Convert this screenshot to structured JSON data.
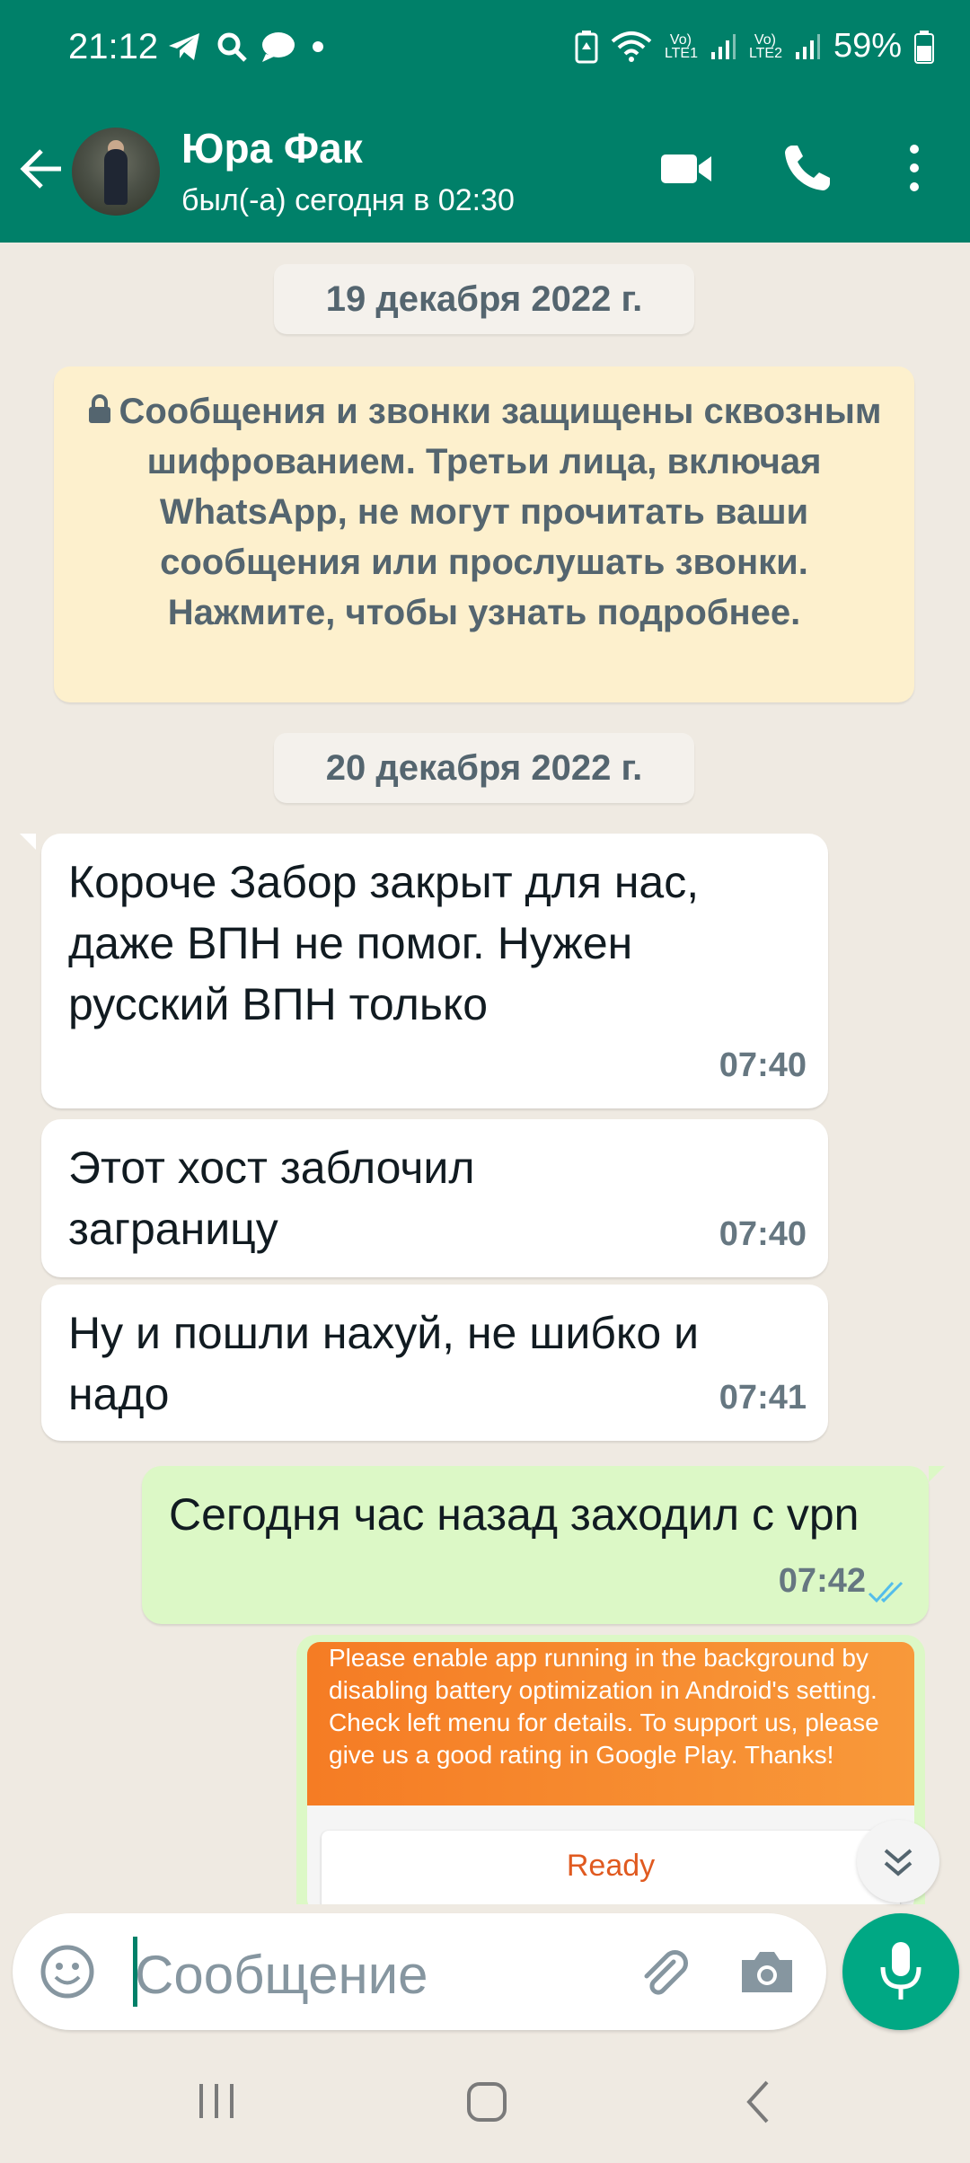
{
  "status_bar": {
    "time": "21:12",
    "sim1_label": "Vo) LTE1",
    "sim2_label": "Vo) LTE2",
    "battery": "59%"
  },
  "header": {
    "contact_name": "Юра Фак",
    "last_seen": "был(-а) сегодня в 02:30",
    "icons": [
      "back-arrow-icon",
      "video-call-icon",
      "voice-call-icon",
      "more-options-icon"
    ]
  },
  "chat": {
    "date1": "19 декабря 2022 г.",
    "encryption_notice": "Сообщения и звонки защищены сквозным шифрованием. Третьи лица, включая WhatsApp, не могут прочитать ваши сообщения или прослушать звонки. Нажмите, чтобы узнать подробнее.",
    "date2": "20 декабря 2022 г.",
    "messages": [
      {
        "direction": "in",
        "text": "Короче Забор закрыт для нас, даже ВПН не помог. Нужен русский ВПН только",
        "time": "07:40"
      },
      {
        "direction": "in",
        "text": "Этот хост заблочил заграницу",
        "time": "07:40"
      },
      {
        "direction": "in",
        "text": "Ну и пошли нахуй, не шибко и надо",
        "time": "07:41"
      },
      {
        "direction": "out",
        "text": "Сегодня час назад заходил с vpn",
        "time": "07:42",
        "status": "read"
      }
    ],
    "image_message": {
      "banner_text": "Please enable app running in the background by disabling battery optimization in Android's setting. Check left menu for details. To support us, please give us a good rating in Google Play. Thanks!",
      "status_text": "Ready"
    }
  },
  "composer": {
    "placeholder": "Сообщение"
  },
  "colors": {
    "header": "#008069",
    "accent": "#00a884",
    "outgoing_bubble": "#dcf8c6",
    "incoming_bubble": "#ffffff",
    "read_ticks": "#53bdeb"
  }
}
